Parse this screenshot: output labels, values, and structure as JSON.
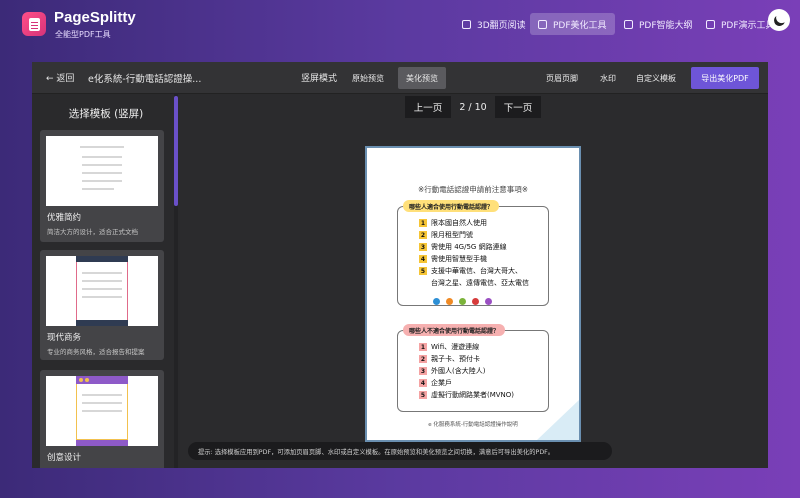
{
  "header": {
    "brand": "PageSplitty",
    "subtitle": "全能型PDF工具",
    "nav": [
      {
        "label": "3D翻页阅读",
        "icon": "book-icon"
      },
      {
        "label": "PDF美化工具",
        "icon": "edit-icon"
      },
      {
        "label": "PDF智能大纲",
        "icon": "outline-icon"
      },
      {
        "label": "PDF演示工具",
        "icon": "present-icon"
      }
    ],
    "active_nav": 1,
    "theme_icon": "moon-icon"
  },
  "toolbar": {
    "back": "← 返回",
    "doc_title": "e化系統-行動電話認證操...",
    "mode": "竖屏模式",
    "tabs": [
      "原始预览",
      "美化预览"
    ],
    "active_tab": 1,
    "actions": [
      "页眉页脚",
      "水印",
      "自定义模板"
    ],
    "export": "导出美化PDF"
  },
  "sidebar": {
    "title": "选择模板 (竖屏)",
    "templates": [
      {
        "name": "优雅简约",
        "desc": "简洁大方的设计，适合正式文档"
      },
      {
        "name": "现代商务",
        "desc": "专业的商务风格，适合报告和提案"
      },
      {
        "name": "创意设计",
        "desc": ""
      }
    ]
  },
  "pager": {
    "prev": "上一页",
    "page": "2 / 10",
    "next": "下一页"
  },
  "document": {
    "title": "※行動電話認證申請前注意事項※",
    "section_ok": {
      "label": "哪些人適合使用行動電話認證？",
      "items": [
        {
          "n": "1",
          "text": "限本國自然人使用"
        },
        {
          "n": "2",
          "text": "限月租型門號"
        },
        {
          "n": "3",
          "text": "需使用 4G/5G 網路連線"
        },
        {
          "n": "4",
          "text": "需使用智慧型手機"
        },
        {
          "n": "5",
          "text": "支援中華電信、台灣大哥大、"
        }
      ],
      "continuation": "台灣之星、遠傳電信、亞太電信"
    },
    "section_no": {
      "label": "哪些人不適合使用行動電話認證？",
      "items": [
        {
          "n": "1",
          "text": "Wifi、漫遊連線"
        },
        {
          "n": "2",
          "text": "親子卡、預付卡"
        },
        {
          "n": "3",
          "text": "外國人(含大陸人)"
        },
        {
          "n": "4",
          "text": "企業戶"
        },
        {
          "n": "5",
          "text": "虛擬行動網路業者(MVNO)"
        }
      ]
    },
    "footer": "e 化服務系統-行動電話認證操作說明",
    "colors": {
      "highlight": "#f6c536",
      "warning": "#f5a3a3",
      "border": "#6a8fb0"
    }
  },
  "tip": "提示: 选择模板应用到PDF，可添加页眉页脚、水印或自定义模板。在原始预览和美化预览之间切换，满意后可导出美化的PDF。"
}
